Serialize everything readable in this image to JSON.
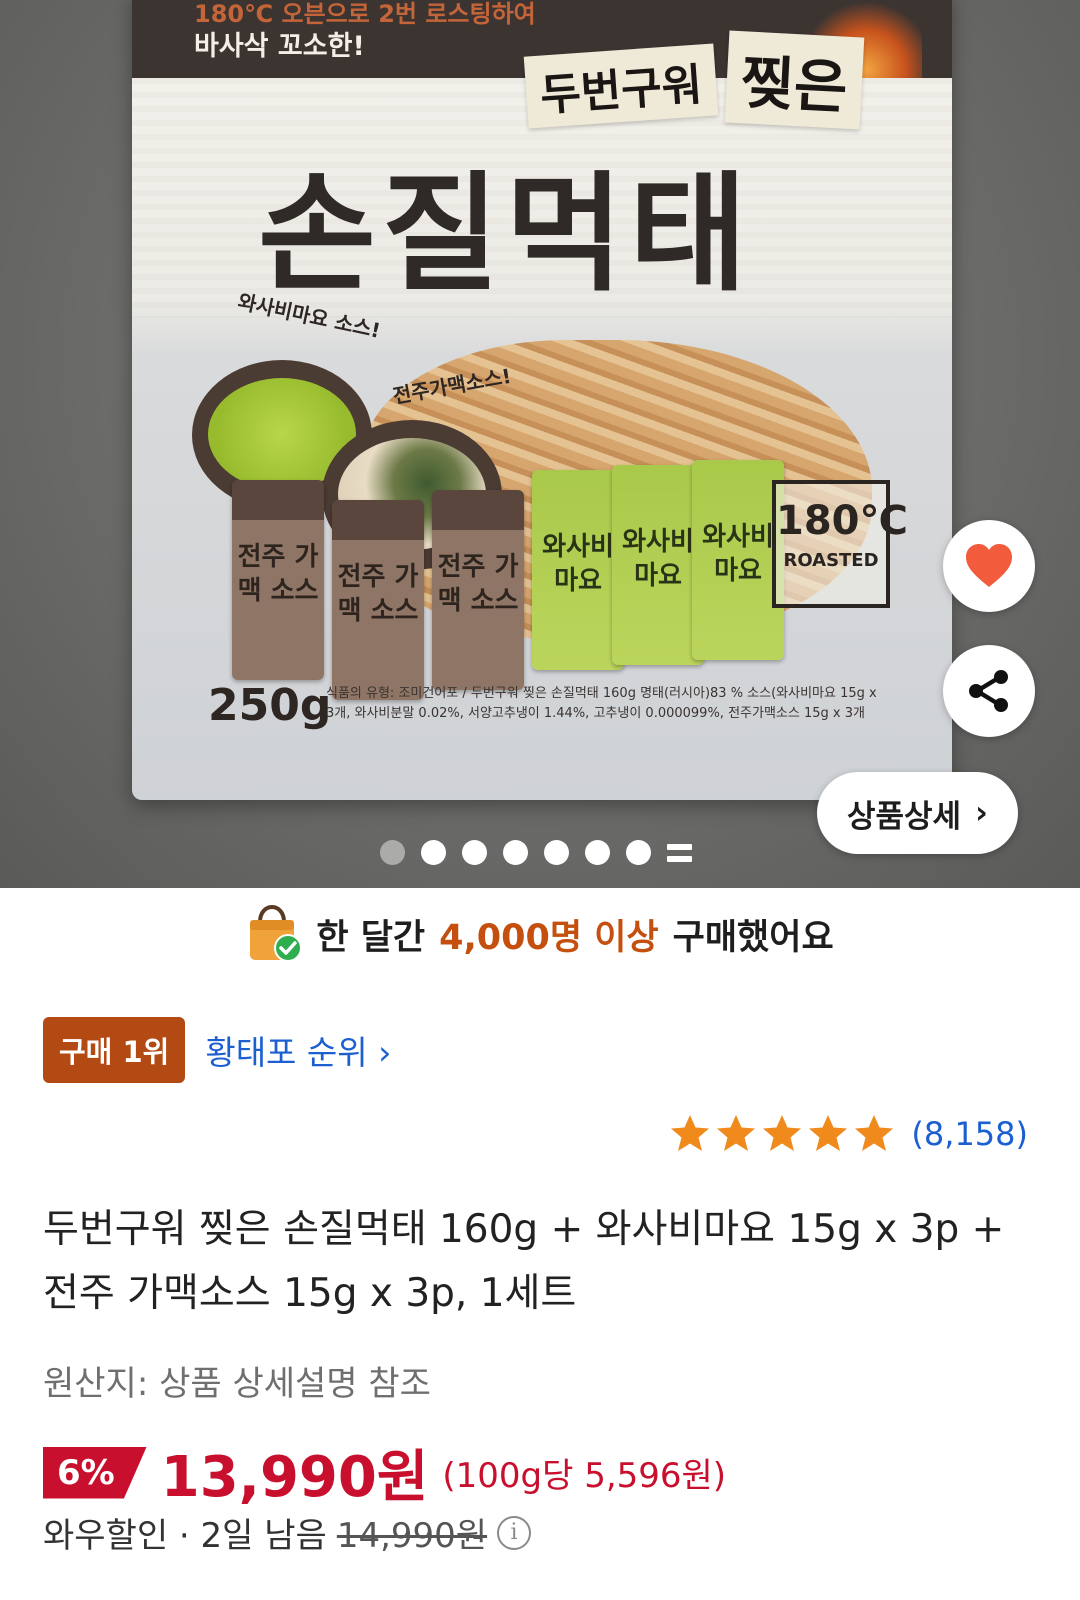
{
  "product_image": {
    "banner_line1": "180℃ 오븐으로 2번 로스팅하여",
    "banner_line2": "바사삭 꼬소한!",
    "tag_a": "두번구워",
    "tag_b": "찢은",
    "product_name": "손질먹태",
    "sauce_a": "와사비마요 소스!",
    "sauce_b": "전주가맥소스!",
    "packet_brown": "전주 가맥 소스",
    "packet_green": "와사비 마요",
    "stamp_temp": "180℃",
    "stamp_text": "ROASTED",
    "weight": "250g",
    "ingredients": "식품의 유형: 조미건어포 / 두번구워 찢은 손질먹태 160g 명태(러시아)83 % 소스(와사비마요 15g x 3개, 와사비분말 0.02%, 서양고추냉이 1.44%, 고추냉이 0.000099%, 전주가맥소스 15g x 3개"
  },
  "actions": {
    "wishlist_icon": "heart-icon",
    "share_icon": "share-icon",
    "detail_label": "상품상세",
    "detail_chevron": "›"
  },
  "carousel": {
    "total": 8,
    "active_index": 0
  },
  "sold": {
    "prefix": "한 달간",
    "highlight": "4,000명 이상",
    "suffix": "구매했어요",
    "icon": "shopping-bag-check-icon"
  },
  "rank": {
    "badge": "구매 1위",
    "link": "황태포 순위",
    "chevron": "›"
  },
  "rating": {
    "stars": 5,
    "count": "(8,158)"
  },
  "product": {
    "title": "두번구워 찢은 손질먹태 160g + 와사비마요 15g x 3p + 전주 가맥소스 15g x 3p, 1세트",
    "origin": "원산지: 상품 상세설명 참조"
  },
  "price": {
    "discount": "6%",
    "sale": "13,990원",
    "unit_price": "(100g당 5,596원)",
    "wow_label": "와우할인 · 2일 남음",
    "original": "14,990원",
    "info_icon": "info-icon"
  },
  "colors": {
    "accent_red": "#c8102e",
    "orange": "#c44f0e",
    "link_blue": "#1c5fd1",
    "star": "#f08a1c",
    "heart": "#f25c3c"
  }
}
